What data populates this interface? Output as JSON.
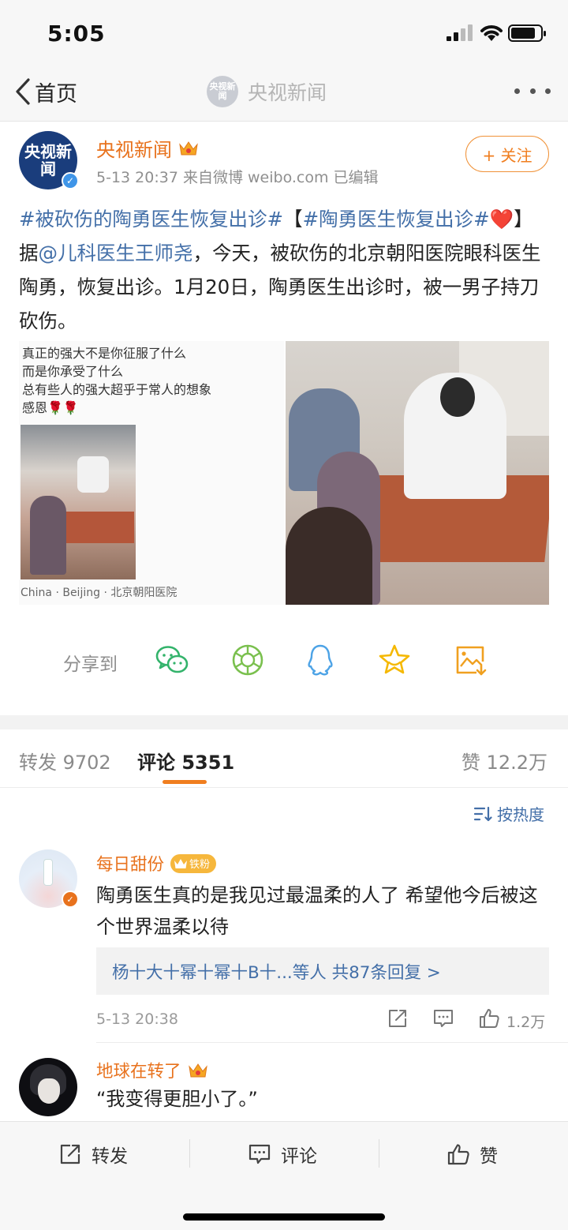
{
  "status_bar": {
    "time": "5:05"
  },
  "nav": {
    "back_label": "首页",
    "logo_text": "央视新闻",
    "title": "央视新闻"
  },
  "post": {
    "avatar_text": "央视新闻",
    "author": "央视新闻",
    "meta": "5-13 20:37  来自微博 weibo.com  已编辑",
    "follow_label": "+ 关注",
    "text": {
      "topic1": "#被砍伤的陶勇医生恢复出诊#",
      "bracket_open": "【",
      "topic2": "#陶勇医生恢复出诊#",
      "heart": "❤️",
      "bracket_close": "】据",
      "mention": "@儿科医生王师尧",
      "body": "，今天，被砍伤的北京朝阳医院眼科医生陶勇，恢复出诊。1月20日，陶勇医生出诊时，被一男子持刀砍伤。"
    },
    "image_left": {
      "lines": [
        "真正的强大不是你征服了什么",
        "而是你承受了什么",
        "总有些人的强大超乎于常人的想象",
        "感恩🌹🌹"
      ],
      "caption": "China · Beijing · 北京朝阳医院"
    }
  },
  "share": {
    "label": "分享到",
    "icons": [
      "wechat-icon",
      "moments-icon",
      "qq-icon",
      "favorite-star-icon",
      "save-image-icon"
    ]
  },
  "tabs": {
    "repost": "转发 9702",
    "comment": "评论 5351",
    "like": "赞 12.2万"
  },
  "sort_label": "按热度",
  "comments": [
    {
      "name": "每日甜份",
      "badge": "铁粉",
      "text": "陶勇医生真的是我见过最温柔的人了 希望他今后被这个世界温柔以待",
      "replies": "杨十大十幂十幂十B十...等人  共87条回复 >",
      "time": "5-13 20:38",
      "likes": "1.2万"
    },
    {
      "name": "地球在转了",
      "text": "“我变得更胆小了。”"
    }
  ],
  "bottom_bar": {
    "repost": "转发",
    "comment": "评论",
    "like": "赞"
  },
  "colors": {
    "accent_orange": "#f07e1f",
    "link_blue": "#436fa8"
  }
}
